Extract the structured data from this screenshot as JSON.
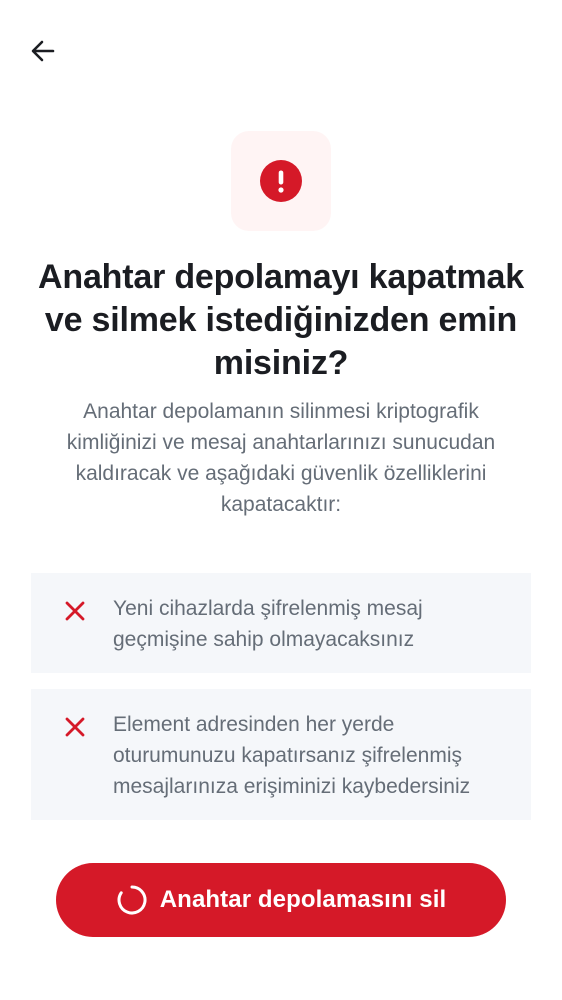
{
  "header": {
    "back_icon": "arrow-left-icon"
  },
  "alert": {
    "icon": "error-icon",
    "tile_color": "#fff4f4",
    "icon_color": "#d51928"
  },
  "title": "Anahtar depolamayı kapatmak ve silmek istediğinizden emin misiniz?",
  "description": "Anahtar depolamanın silinmesi kriptografik kimliğinizi ve mesaj anahtarlarınızı sunucudan kaldıracak ve aşağıdaki güvenlik özelliklerini kapatacaktır:",
  "consequences": [
    {
      "icon": "close-icon",
      "text": "Yeni cihazlarda şifrelenmiş mesaj geçmişine sahip olmayacaksınız"
    },
    {
      "icon": "close-icon",
      "text": "Element adresinden her yerde oturumunuzu kapatırsanız şifrelenmiş mesajlarınıza erişiminizi kaybedersiniz"
    }
  ],
  "delete_button": {
    "label": "Anahtar depolamasını sil",
    "icon": "loading-spinner-icon",
    "color": "#d51928"
  }
}
